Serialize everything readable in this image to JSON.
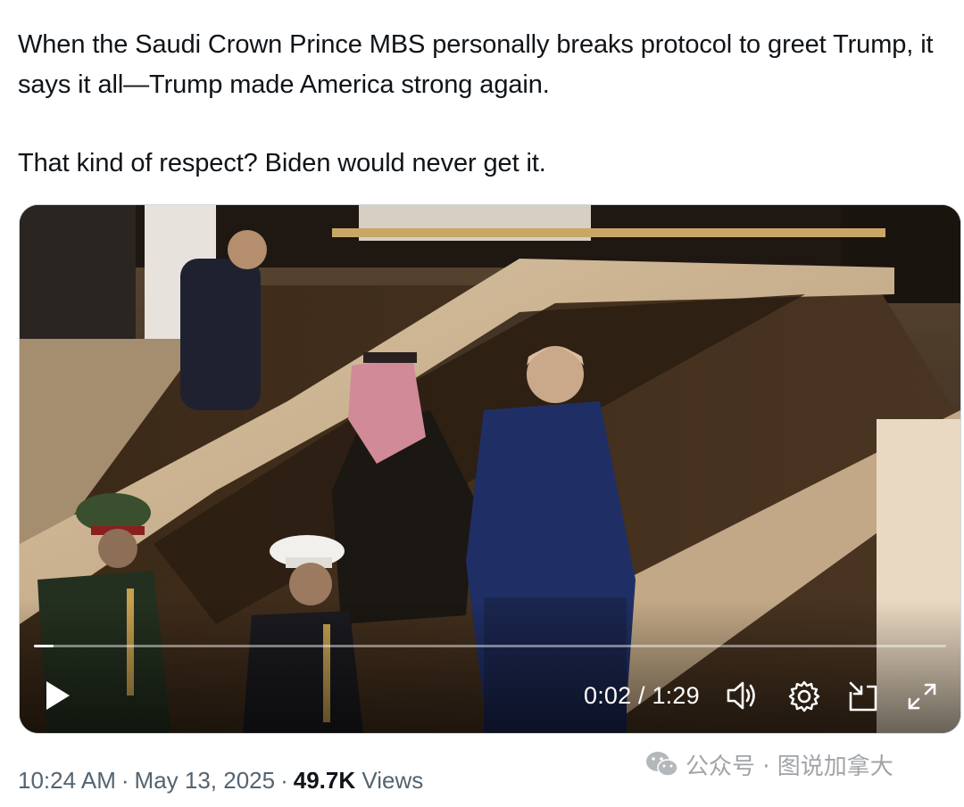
{
  "tweet": {
    "line1": "When the Saudi Crown Prince MBS personally breaks protocol to greet Trump, it says it all—Trump made America strong again.",
    "line2": "That kind of respect? Biden would never get it."
  },
  "video": {
    "time": "0:02 / 1:29",
    "progress_fraction": 0.022,
    "icons": [
      "play-icon",
      "volume-icon",
      "settings-gear-icon",
      "picture-in-picture-icon",
      "fullscreen-icon"
    ]
  },
  "meta": {
    "time": "10:24 AM",
    "date": "May 13, 2025",
    "separator": "·",
    "views_count": "49.7K",
    "views_label": "Views"
  },
  "watermark": {
    "text": "公众号 · 图说加拿大"
  },
  "colors": {
    "text": "#0f1419",
    "secondary": "#536471",
    "border": "#cfd9de",
    "watermark": "#a0a4a8"
  }
}
